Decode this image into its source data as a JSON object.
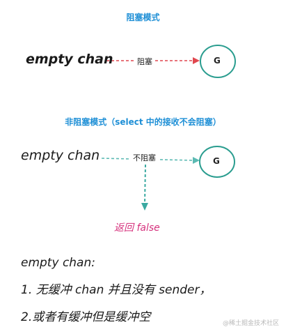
{
  "section1": {
    "title": "阻塞模式",
    "source": "empty chan",
    "edge_label": "阻塞",
    "target": "G"
  },
  "section2": {
    "title": "非阻塞模式（select 中的接收不会阻塞）",
    "source": "empty chan",
    "edge_label": "不阻塞",
    "target": "G",
    "result": "返回 false"
  },
  "notes": {
    "line1": "empty chan:",
    "line2": "1. 无缓冲 chan 并且没有 sender，",
    "line3": "2.或者有缓冲但是缓冲空"
  },
  "watermark": "@稀土掘金技术社区",
  "colors": {
    "title": "#1e8fd6",
    "block_edge": "#e0474f",
    "nonblock_edge": "#5cbab3",
    "return_text": "#d6327d",
    "node_stroke": "#2aa198"
  }
}
